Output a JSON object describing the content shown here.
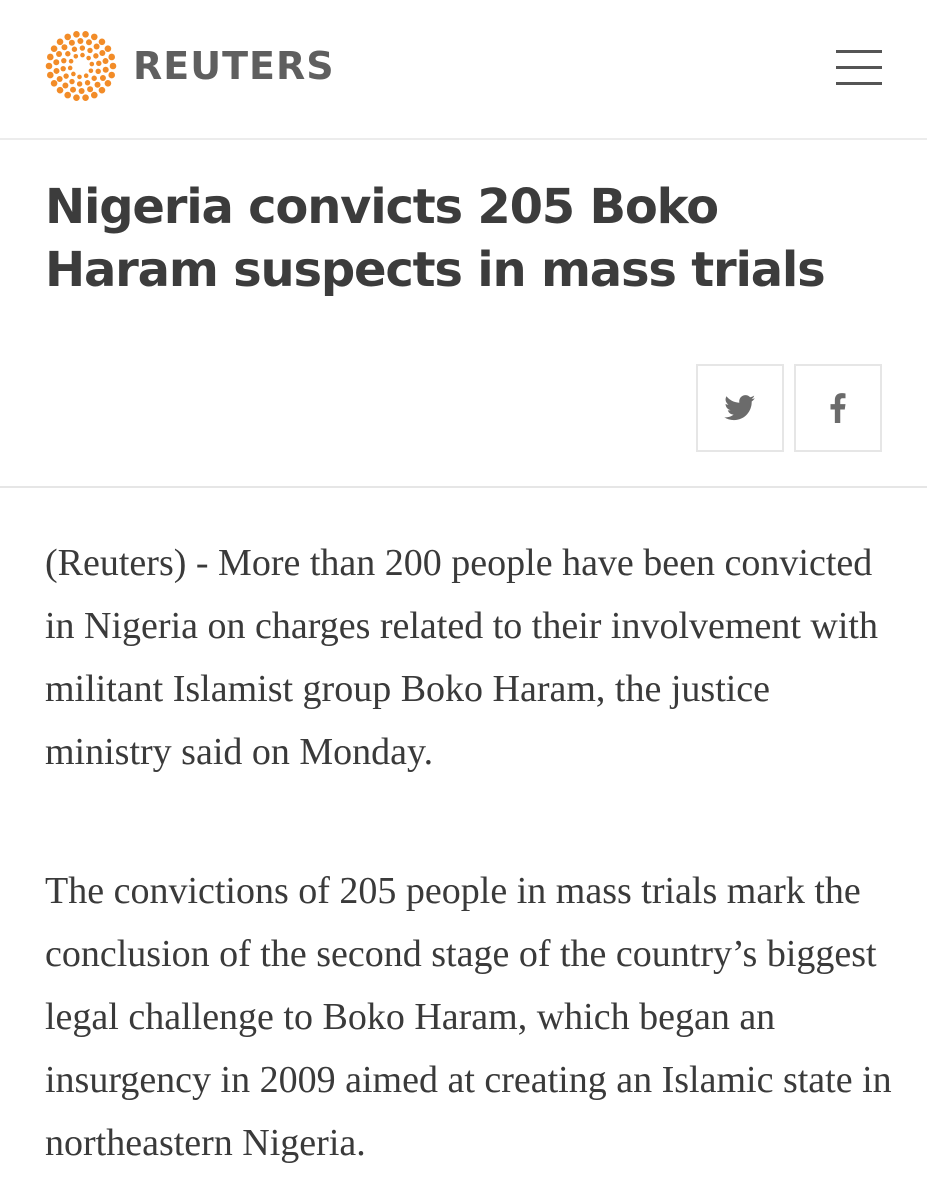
{
  "header": {
    "brand_name": "REUTERS",
    "logo_color": "#f28c28",
    "menu_icon": "hamburger-menu-icon"
  },
  "article": {
    "headline": "Nigeria convicts 205 Boko Haram suspects in mass trials",
    "share": {
      "twitter_icon": "twitter-icon",
      "facebook_icon": "facebook-icon"
    },
    "paragraphs": [
      "(Reuters) - More than 200 people have been convicted in Nigeria on charges related to their involvement with militant Islamist group Boko Haram, the justice ministry said on Monday.",
      "The convictions of 205 people in mass trials mark the conclusion of the second stage of the country’s biggest legal challenge to Boko Haram, which began an insurgency in 2009 aimed at creating an Islamic state in northeastern Nigeria."
    ]
  },
  "colors": {
    "text": "#3a3a3a",
    "logo_text": "#5f5f5f",
    "divider": "#e6e6e6"
  }
}
